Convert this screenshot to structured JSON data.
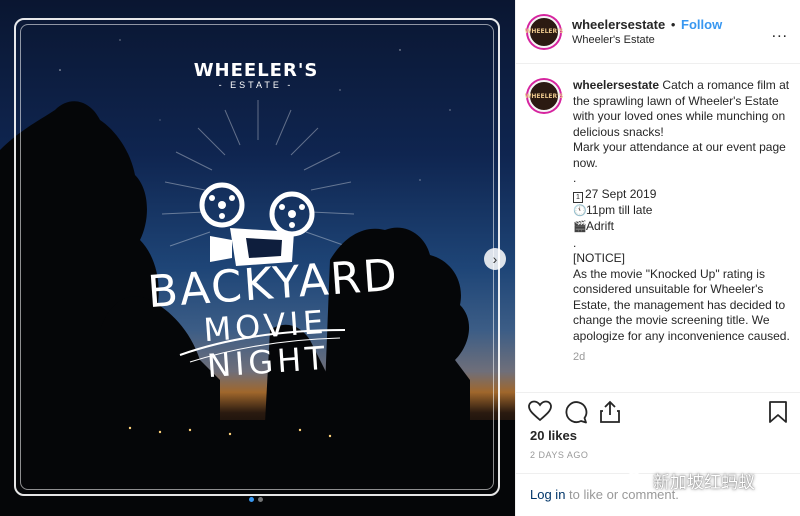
{
  "post": {
    "brand_name": "WHEELER'S",
    "brand_sub": "- ESTATE -",
    "title_line1": "BACKYARD",
    "title_line2": "MOVIE NIGHT",
    "next_arrow": "›"
  },
  "header": {
    "username": "wheelersestate",
    "separator": "•",
    "follow_label": "Follow",
    "location": "Wheeler's Estate",
    "avatar_text": "WHEELER'S",
    "more_icon": "..."
  },
  "caption": {
    "username": "wheelersestate",
    "text": "Catch a romance film at the sprawling lawn of Wheeler's Estate with your loved ones while munching on delicious snacks!",
    "line2": "Mark your attendance at our event page now.",
    "dot1": ".",
    "calendar_icon": "1",
    "date": "27 Sept 2019",
    "clock_icon": "🕚",
    "time": "11pm till late",
    "clapper_icon": "🎬",
    "venue": "Adrift",
    "dot2": ".",
    "notice": "[NOTICE]",
    "notice_body": "As the movie \"Knocked Up\" rating is considered unsuitable for Wheeler's Estate, the management has decided to change the movie screening title. We apologize for any inconvenience caused.",
    "age": "2d"
  },
  "actions": {
    "likes": "20 likes",
    "posted": "2 DAYS AGO",
    "login_link": "Log in",
    "login_rest": " to like or comment."
  },
  "watermark": {
    "text": "新加坡红蚂蚁"
  },
  "colors": {
    "accent": "#3897f0",
    "text": "#262626",
    "muted": "#999999"
  }
}
